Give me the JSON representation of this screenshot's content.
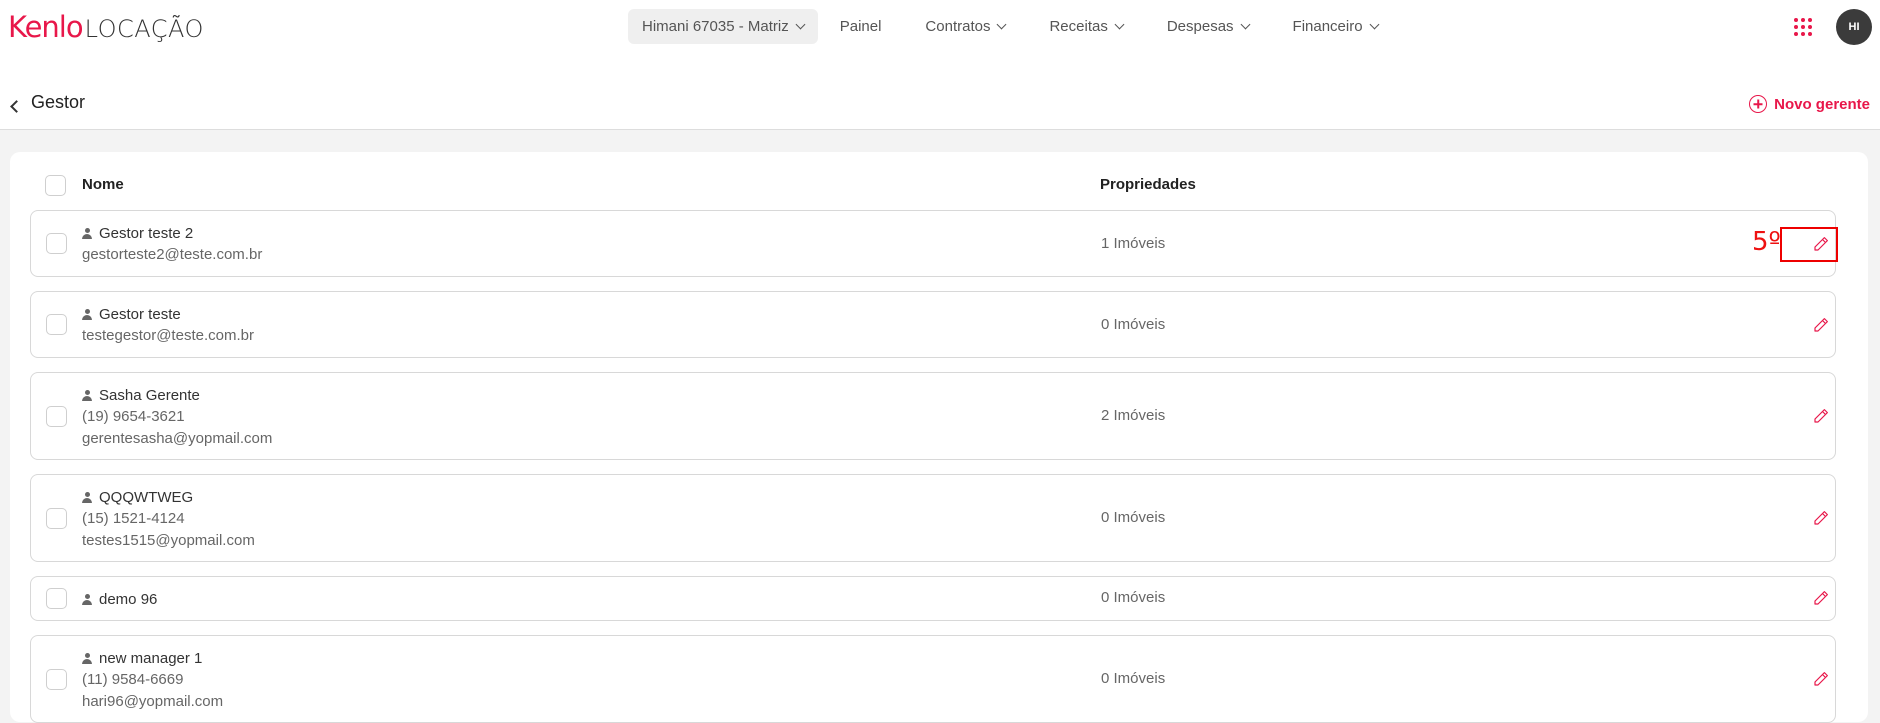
{
  "header": {
    "logo_brand": "Kenlo",
    "logo_product": "LOCAÇÃO",
    "nav": [
      {
        "label": "Himani 67035 - Matriz",
        "dropdown": true,
        "selected": true
      },
      {
        "label": "Painel",
        "dropdown": false
      },
      {
        "label": "Contratos",
        "dropdown": true
      },
      {
        "label": "Receitas",
        "dropdown": true
      },
      {
        "label": "Despesas",
        "dropdown": true
      },
      {
        "label": "Financeiro",
        "dropdown": true
      }
    ],
    "apps_icon": "grid-dots-icon",
    "avatar_initials": "HI"
  },
  "page": {
    "title": "Gestor",
    "new_button": "Novo gerente"
  },
  "table": {
    "columns": {
      "name": "Nome",
      "properties": "Propriedades"
    },
    "rows": [
      {
        "name": "Gestor teste 2",
        "lines": [
          "gestorteste2@teste.com.br"
        ],
        "properties": "1 Imóveis"
      },
      {
        "name": "Gestor teste",
        "lines": [
          "testegestor@teste.com.br"
        ],
        "properties": "0 Imóveis"
      },
      {
        "name": "Sasha Gerente",
        "lines": [
          "(19) 9654-3621",
          "gerentesasha@yopmail.com"
        ],
        "properties": "2 Imóveis"
      },
      {
        "name": "QQQWTWEG",
        "lines": [
          "(15) 1521-4124",
          "testes1515@yopmail.com"
        ],
        "properties": "0 Imóveis"
      },
      {
        "name": "demo 96",
        "lines": [],
        "properties": "0 Imóveis"
      },
      {
        "name": "new manager 1",
        "lines": [
          "(11) 9584-6669",
          "hari96@yopmail.com"
        ],
        "properties": "0 Imóveis"
      }
    ]
  },
  "annotation": {
    "label": "5º"
  },
  "colors": {
    "accent": "#e8174a",
    "annotation": "#ee1111"
  }
}
